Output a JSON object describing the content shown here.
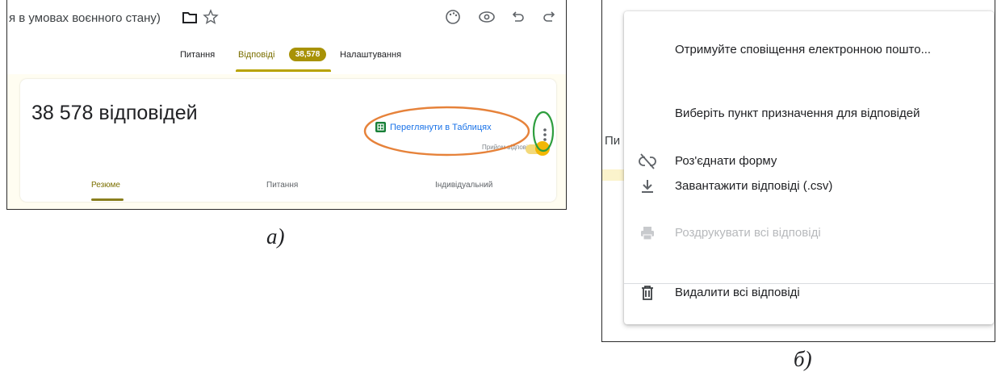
{
  "panel_a": {
    "doc_title": "я в умовах воєнного стану)",
    "tabs": {
      "questions": "Питання",
      "responses": "Відповіді",
      "settings": "Налаштування"
    },
    "responses_badge": "38,578",
    "response_count": "38 578 відповідей",
    "sheets_link": "Переглянути в Таблицях",
    "accepting_label": "Прийом відповідей",
    "subtabs": {
      "summary": "Резюме",
      "question": "Питання",
      "individual": "Індивідуальний"
    },
    "caption": "а)",
    "colors": {
      "accent": "#b8a300",
      "badge": "#a89206",
      "toggle": "#f2b705",
      "link": "#1a73e8",
      "highlight_orange": "#e6823a",
      "highlight_green": "#2e9e3e"
    }
  },
  "panel_b": {
    "behind_text": "Пи",
    "menu": [
      {
        "label": "Отримуйте сповіщення електронною пошто...",
        "icon": "",
        "disabled": false
      },
      {
        "label": "Виберіть пункт призначення для відповідей",
        "icon": "",
        "disabled": false
      },
      {
        "label": "Роз'єднати форму",
        "icon": "unlink-icon",
        "disabled": false
      },
      {
        "label": "Завантажити відповіді (.csv)",
        "icon": "download-icon",
        "disabled": false
      },
      {
        "label": "Роздрукувати всі відповіді",
        "icon": "print-icon",
        "disabled": true
      },
      {
        "label": "Видалити всі відповіді",
        "icon": "trash-icon",
        "disabled": false
      }
    ],
    "caption": "б)"
  }
}
